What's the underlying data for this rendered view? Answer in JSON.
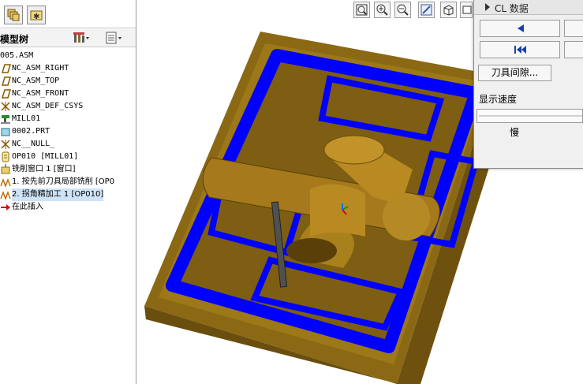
{
  "model_tree": {
    "title": "模型树",
    "items": [
      {
        "label": "005.ASM",
        "icon": "assembly-icon"
      },
      {
        "label": "NC_ASM_RIGHT",
        "icon": "datum-plane-icon"
      },
      {
        "label": "NC_ASM_TOP",
        "icon": "datum-plane-icon"
      },
      {
        "label": "NC_ASM_FRONT",
        "icon": "datum-plane-icon"
      },
      {
        "label": "NC_ASM_DEF_CSYS",
        "icon": "csys-icon"
      },
      {
        "label": "MILL01",
        "icon": "machine-icon"
      },
      {
        "label": "0002.PRT",
        "icon": "part-icon"
      },
      {
        "label": "NC__NULL_",
        "icon": "csys-icon"
      },
      {
        "label": "OP010 [MILL01]",
        "icon": "operation-icon"
      },
      {
        "label": "铣削窗口 1 [窗口]",
        "icon": "mill-window-icon"
      },
      {
        "label": "1. 按先前刀具局部铣削 [OP0",
        "icon": "toolpath-icon"
      },
      {
        "label": "2. 拐角精加工 1 [OP010]",
        "icon": "toolpath-icon"
      },
      {
        "label": "在此插入",
        "icon": "insert-arrow-icon"
      }
    ]
  },
  "cl_panel": {
    "title": "CL 数据",
    "tool_gap_label": "刀具间隙...",
    "speed_label": "显示速度",
    "speed_value": "慢"
  },
  "colors": {
    "mold": "#8b6914",
    "toolpath": "#0000ff",
    "tool": "#505050"
  }
}
